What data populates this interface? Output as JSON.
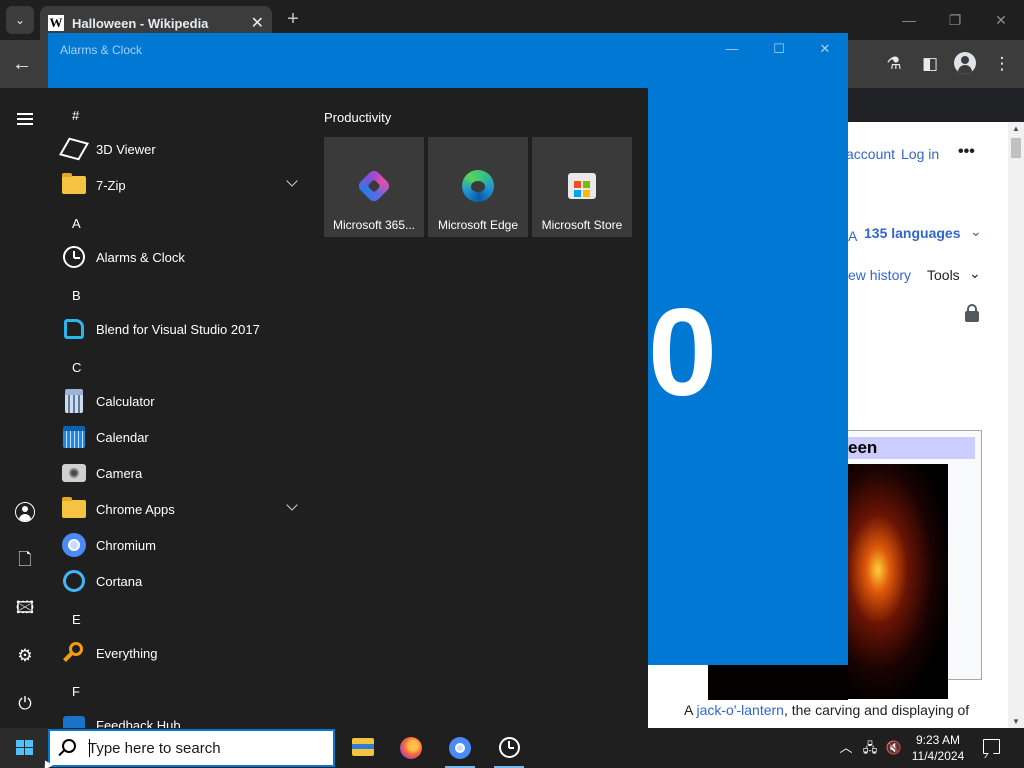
{
  "browser": {
    "tab": {
      "favicon": "W",
      "title": "Halloween - Wikipedia",
      "close": "✕"
    },
    "new_tab": "+",
    "window_controls": {
      "minimize": "—",
      "maximize": "❐",
      "close": "✕"
    },
    "toolbar": {
      "back": "←",
      "menu": "⋮"
    }
  },
  "wiki": {
    "account": "account",
    "login": "Log in",
    "more": "•••",
    "languages": "135 languages",
    "view_history": "ew history",
    "tools": "Tools",
    "infobox_title": "een",
    "caption_link": "jack-o'-lantern",
    "caption_prefix": "A",
    "caption_rest": ", the carving and displaying of"
  },
  "alarms": {
    "title": "Alarms & Clock",
    "big_text": "0",
    "controls": {
      "minimize": "—",
      "maximize": "☐",
      "close": "✕"
    }
  },
  "start_menu": {
    "letters": [
      "#",
      "A",
      "B",
      "C",
      "E",
      "F"
    ],
    "apps": [
      {
        "label": "3D Viewer"
      },
      {
        "label": "7-Zip"
      },
      {
        "label": "Alarms & Clock"
      },
      {
        "label": "Blend for Visual Studio 2017"
      },
      {
        "label": "Calculator"
      },
      {
        "label": "Calendar"
      },
      {
        "label": "Camera"
      },
      {
        "label": "Chrome Apps"
      },
      {
        "label": "Chromium"
      },
      {
        "label": "Cortana"
      },
      {
        "label": "Everything"
      },
      {
        "label": "Feedback Hub"
      }
    ],
    "group_title": "Productivity",
    "tiles": [
      {
        "label": "Microsoft 365..."
      },
      {
        "label": "Microsoft Edge"
      },
      {
        "label": "Microsoft Store"
      }
    ]
  },
  "taskbar": {
    "search_placeholder": "Type here to search",
    "time": "9:23 AM",
    "date": "11/4/2024",
    "tray_chevron": "︿"
  },
  "colors": {
    "accent": "#0078d4",
    "start_bg": "#1f1f1f",
    "tile_bg": "#3a3a3a"
  }
}
